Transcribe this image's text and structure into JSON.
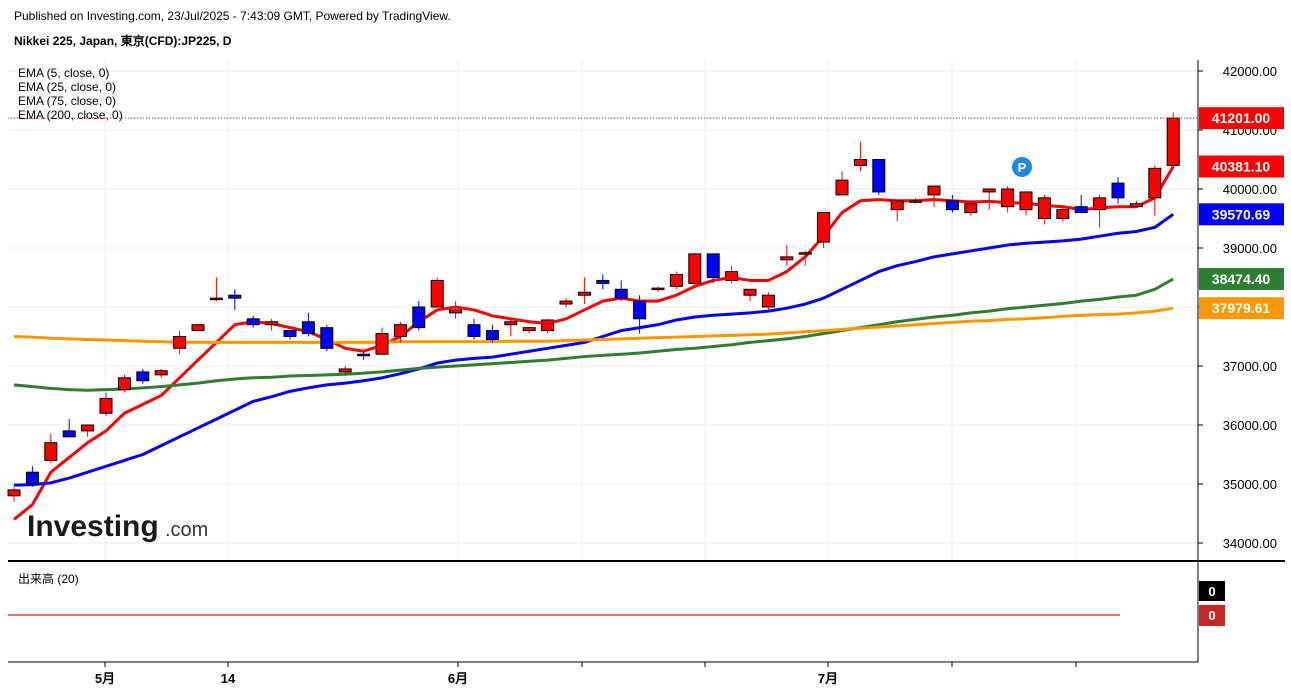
{
  "header": {
    "published": "Published on Investing.com, 23/Jul/2025 - 7:43:09 GMT, Powered by TradingView.",
    "symbol": "Nikkei 225, Japan, 東京(CFD):JP225, D"
  },
  "logo": {
    "text": "Investing",
    "suffix": ".com"
  },
  "indicators": [
    "EMA (5, close, 0)",
    "EMA (25, close, 0)",
    "EMA (75, close, 0)",
    "EMA (200, close, 0)"
  ],
  "volume_panel": {
    "label": "出来高 (20)",
    "values": [
      "0",
      "0"
    ]
  },
  "marker": {
    "text": "P",
    "color": "#1e88e5"
  },
  "colors": {
    "up": "#ff0000",
    "down": "#0000ff",
    "ema5": "#ff0000",
    "ema25": "#0000ff",
    "ema75": "#2e7d32",
    "ema200": "#ff9800"
  },
  "chart_data": {
    "type": "candlestick",
    "y_ticks": [
      "42000.00",
      "41000.00",
      "40000.00",
      "39000.00",
      "38000.00",
      "37000.00",
      "36000.00",
      "35000.00",
      "34000.00"
    ],
    "ylim": [
      33700,
      42200
    ],
    "x_ticks": [
      "5月",
      "14",
      "6月",
      "7月"
    ],
    "last_price": "41201.00",
    "candles": [
      {
        "o": 34800,
        "h": 34950,
        "l": 34700,
        "c": 34900
      },
      {
        "o": 35200,
        "h": 35300,
        "l": 34950,
        "c": 35000
      },
      {
        "o": 35400,
        "h": 35850,
        "l": 35350,
        "c": 35700
      },
      {
        "o": 35900,
        "h": 36100,
        "l": 35800,
        "c": 35800
      },
      {
        "o": 35900,
        "h": 36000,
        "l": 35800,
        "c": 36000
      },
      {
        "o": 36200,
        "h": 36550,
        "l": 36150,
        "c": 36450
      },
      {
        "o": 36600,
        "h": 36850,
        "l": 36550,
        "c": 36800
      },
      {
        "o": 36900,
        "h": 36950,
        "l": 36700,
        "c": 36750
      },
      {
        "o": 36850,
        "h": 36950,
        "l": 36800,
        "c": 36920
      },
      {
        "o": 37300,
        "h": 37600,
        "l": 37200,
        "c": 37500
      },
      {
        "o": 37600,
        "h": 37700,
        "l": 37600,
        "c": 37700
      },
      {
        "o": 38150,
        "h": 38500,
        "l": 38100,
        "c": 38150
      },
      {
        "o": 38200,
        "h": 38300,
        "l": 37950,
        "c": 38150
      },
      {
        "o": 37800,
        "h": 37850,
        "l": 37650,
        "c": 37700
      },
      {
        "o": 37700,
        "h": 37800,
        "l": 37600,
        "c": 37750
      },
      {
        "o": 37600,
        "h": 37600,
        "l": 37450,
        "c": 37500
      },
      {
        "o": 37750,
        "h": 37900,
        "l": 37500,
        "c": 37550
      },
      {
        "o": 37650,
        "h": 37700,
        "l": 37250,
        "c": 37300
      },
      {
        "o": 36900,
        "h": 37000,
        "l": 36850,
        "c": 36950
      },
      {
        "o": 37200,
        "h": 37250,
        "l": 37100,
        "c": 37180
      },
      {
        "o": 37200,
        "h": 37650,
        "l": 37200,
        "c": 37550
      },
      {
        "o": 37500,
        "h": 37750,
        "l": 37400,
        "c": 37700
      },
      {
        "o": 38000,
        "h": 38100,
        "l": 37600,
        "c": 37650
      },
      {
        "o": 38000,
        "h": 38500,
        "l": 38000,
        "c": 38450
      },
      {
        "o": 37900,
        "h": 38100,
        "l": 37800,
        "c": 37950
      },
      {
        "o": 37700,
        "h": 37800,
        "l": 37450,
        "c": 37500
      },
      {
        "o": 37600,
        "h": 37700,
        "l": 37400,
        "c": 37450
      },
      {
        "o": 37700,
        "h": 37800,
        "l": 37500,
        "c": 37750
      },
      {
        "o": 37600,
        "h": 37650,
        "l": 37550,
        "c": 37650
      },
      {
        "o": 37600,
        "h": 37800,
        "l": 37550,
        "c": 37780
      },
      {
        "o": 38050,
        "h": 38150,
        "l": 38000,
        "c": 38100
      },
      {
        "o": 38200,
        "h": 38500,
        "l": 38050,
        "c": 38250
      },
      {
        "o": 38450,
        "h": 38550,
        "l": 38300,
        "c": 38400
      },
      {
        "o": 38300,
        "h": 38450,
        "l": 38100,
        "c": 38150
      },
      {
        "o": 38100,
        "h": 38200,
        "l": 37550,
        "c": 37800
      },
      {
        "o": 38300,
        "h": 38350,
        "l": 38250,
        "c": 38320
      },
      {
        "o": 38350,
        "h": 38600,
        "l": 38300,
        "c": 38550
      },
      {
        "o": 38400,
        "h": 38900,
        "l": 38350,
        "c": 38900
      },
      {
        "o": 38900,
        "h": 38900,
        "l": 38400,
        "c": 38500
      },
      {
        "o": 38450,
        "h": 38700,
        "l": 38400,
        "c": 38600
      },
      {
        "o": 38200,
        "h": 38300,
        "l": 38100,
        "c": 38300
      },
      {
        "o": 38000,
        "h": 38250,
        "l": 37950,
        "c": 38200
      },
      {
        "o": 38800,
        "h": 39050,
        "l": 38700,
        "c": 38850
      },
      {
        "o": 38900,
        "h": 38950,
        "l": 38700,
        "c": 38920
      },
      {
        "o": 39100,
        "h": 39600,
        "l": 39000,
        "c": 39600
      },
      {
        "o": 39900,
        "h": 40300,
        "l": 39900,
        "c": 40150
      },
      {
        "o": 40400,
        "h": 40800,
        "l": 40300,
        "c": 40500
      },
      {
        "o": 40500,
        "h": 40500,
        "l": 39900,
        "c": 39950
      },
      {
        "o": 39650,
        "h": 39750,
        "l": 39450,
        "c": 39800
      },
      {
        "o": 39800,
        "h": 39850,
        "l": 39750,
        "c": 39800
      },
      {
        "o": 39900,
        "h": 40050,
        "l": 39700,
        "c": 40050
      },
      {
        "o": 39800,
        "h": 39900,
        "l": 39600,
        "c": 39650
      },
      {
        "o": 39600,
        "h": 39800,
        "l": 39550,
        "c": 39750
      },
      {
        "o": 39950,
        "h": 40000,
        "l": 39650,
        "c": 40000
      },
      {
        "o": 39700,
        "h": 40050,
        "l": 39600,
        "c": 40000
      },
      {
        "o": 39650,
        "h": 39950,
        "l": 39550,
        "c": 39950
      },
      {
        "o": 39500,
        "h": 39900,
        "l": 39400,
        "c": 39850
      },
      {
        "o": 39500,
        "h": 39700,
        "l": 39450,
        "c": 39650
      },
      {
        "o": 39700,
        "h": 39900,
        "l": 39600,
        "c": 39600
      },
      {
        "o": 39650,
        "h": 39900,
        "l": 39350,
        "c": 39850
      },
      {
        "o": 40100,
        "h": 40200,
        "l": 39750,
        "c": 39850
      },
      {
        "o": 39700,
        "h": 39800,
        "l": 39700,
        "c": 39750
      },
      {
        "o": 39850,
        "h": 40400,
        "l": 39550,
        "c": 40350
      },
      {
        "o": 40400,
        "h": 41300,
        "l": 40350,
        "c": 41201
      }
    ],
    "series": [
      {
        "name": "EMA (5, close, 0)",
        "last": "40381.10",
        "values": [
          34400,
          34650,
          35200,
          35450,
          35700,
          35900,
          36200,
          36350,
          36500,
          36800,
          37100,
          37400,
          37700,
          37750,
          37720,
          37650,
          37580,
          37450,
          37300,
          37250,
          37350,
          37500,
          37750,
          37950,
          38000,
          37950,
          37850,
          37800,
          37750,
          37720,
          37800,
          37950,
          38100,
          38150,
          38100,
          38100,
          38200,
          38350,
          38450,
          38500,
          38450,
          38450,
          38600,
          38850,
          39200,
          39600,
          39800,
          39820,
          39800,
          39800,
          39820,
          39800,
          39780,
          39790,
          39770,
          39760,
          39720,
          39700,
          39650,
          39680,
          39700,
          39700,
          39850,
          40381
        ]
      },
      {
        "name": "EMA (25, close, 0)",
        "last": "39570.69",
        "values": [
          34980,
          34990,
          35020,
          35100,
          35200,
          35300,
          35400,
          35500,
          35650,
          35800,
          35950,
          36100,
          36250,
          36400,
          36480,
          36570,
          36630,
          36680,
          36710,
          36750,
          36800,
          36870,
          36950,
          37050,
          37100,
          37130,
          37150,
          37200,
          37250,
          37300,
          37350,
          37400,
          37500,
          37600,
          37650,
          37700,
          37780,
          37830,
          37860,
          37880,
          37900,
          37930,
          37980,
          38050,
          38150,
          38300,
          38450,
          38600,
          38700,
          38770,
          38850,
          38900,
          38950,
          39000,
          39050,
          39080,
          39100,
          39120,
          39150,
          39200,
          39250,
          39280,
          39350,
          39571
        ]
      },
      {
        "name": "EMA (75, close, 0)",
        "last": "38474.40",
        "values": [
          36680,
          36650,
          36620,
          36600,
          36590,
          36600,
          36610,
          36630,
          36650,
          36680,
          36710,
          36750,
          36780,
          36800,
          36810,
          36830,
          36840,
          36850,
          36860,
          36880,
          36900,
          36930,
          36960,
          36980,
          37000,
          37020,
          37040,
          37060,
          37080,
          37100,
          37130,
          37160,
          37180,
          37200,
          37220,
          37250,
          37280,
          37300,
          37330,
          37360,
          37400,
          37430,
          37460,
          37500,
          37550,
          37600,
          37650,
          37700,
          37750,
          37790,
          37830,
          37860,
          37900,
          37930,
          37970,
          38000,
          38030,
          38060,
          38100,
          38130,
          38170,
          38200,
          38300,
          38474
        ]
      },
      {
        "name": "EMA (200, close, 0)",
        "last": "37979.61",
        "values": [
          37500,
          37490,
          37470,
          37460,
          37450,
          37440,
          37430,
          37420,
          37410,
          37405,
          37400,
          37400,
          37400,
          37400,
          37400,
          37400,
          37400,
          37400,
          37400,
          37400,
          37405,
          37410,
          37410,
          37410,
          37410,
          37410,
          37415,
          37420,
          37420,
          37420,
          37430,
          37440,
          37450,
          37460,
          37470,
          37480,
          37490,
          37500,
          37510,
          37520,
          37530,
          37540,
          37560,
          37580,
          37600,
          37620,
          37640,
          37660,
          37680,
          37700,
          37720,
          37740,
          37760,
          37770,
          37790,
          37800,
          37820,
          37840,
          37860,
          37870,
          37880,
          37900,
          37930,
          37980
        ]
      }
    ]
  }
}
